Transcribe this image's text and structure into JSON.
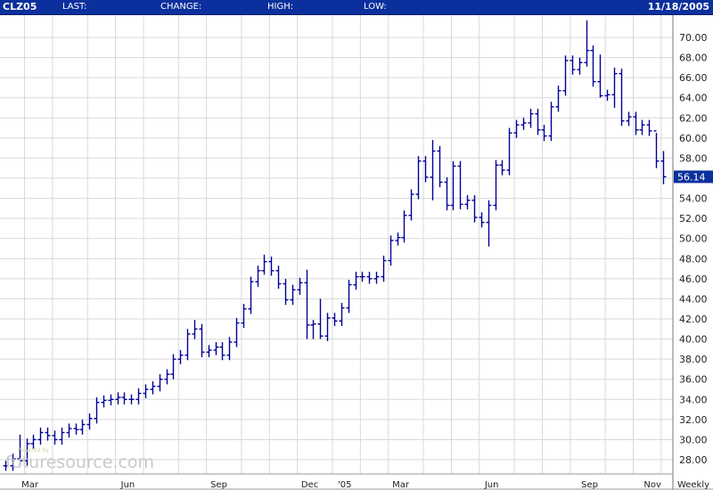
{
  "header": {
    "symbol": "CLZ05",
    "last_label": "LAST:",
    "change_label": "CHANGE:",
    "high_label": "HIGH:",
    "low_label": "LOW:",
    "date": "11/18/2005"
  },
  "logo": {
    "text": "futuresource.com",
    "tagline": "Powered by"
  },
  "colors": {
    "header": "#0b2f9c",
    "bars": "#000099",
    "grid": "#d9d9d9",
    "last_box": "#0b2f9c"
  },
  "chart_data": {
    "type": "ohlc",
    "title": "CLZ05",
    "period_label": "Weekly",
    "ylim": [
      26.6,
      72.6
    ],
    "y_ticks": [
      "28.00",
      "30.00",
      "32.00",
      "34.00",
      "36.00",
      "38.00",
      "40.00",
      "42.00",
      "44.00",
      "46.00",
      "48.00",
      "50.00",
      "52.00",
      "54.00",
      "56.00",
      "58.00",
      "60.00",
      "62.00",
      "64.00",
      "66.00",
      "68.00",
      "70.00"
    ],
    "x_labels": [
      {
        "label": "Mar",
        "week": 3
      },
      {
        "label": "Jun",
        "week": 17
      },
      {
        "label": "Sep",
        "week": 30
      },
      {
        "label": "Dec",
        "week": 43
      },
      {
        "label": "'05",
        "week": 48
      },
      {
        "label": "Mar",
        "week": 56
      },
      {
        "label": "Jun",
        "week": 69
      },
      {
        "label": "Sep",
        "week": 83
      },
      {
        "label": "Nov",
        "week": 92
      }
    ],
    "last_price": "56.14",
    "close": [
      27.4,
      28.1,
      27.9,
      29.6,
      30.0,
      30.7,
      30.4,
      30.0,
      30.7,
      31.1,
      31.0,
      31.5,
      32.1,
      33.7,
      33.9,
      34.0,
      34.2,
      34.0,
      34.0,
      34.6,
      35.0,
      35.3,
      36.0,
      36.5,
      38.0,
      38.4,
      40.5,
      41.0,
      38.7,
      38.9,
      39.2,
      38.4,
      39.7,
      41.6,
      43.0,
      45.7,
      46.8,
      47.7,
      46.8,
      45.5,
      43.9,
      44.9,
      45.6,
      41.4,
      41.5,
      40.3,
      42.1,
      41.8,
      43.1,
      45.4,
      46.2,
      46.2,
      46.0,
      46.2,
      47.8,
      49.8,
      50.1,
      52.3,
      54.4,
      57.7,
      56.1,
      58.7,
      55.6,
      53.3,
      57.2,
      53.4,
      53.8,
      52.1,
      51.6,
      53.3,
      57.3,
      56.8,
      60.5,
      61.3,
      61.5,
      62.4,
      60.8,
      60.2,
      63.1,
      64.7,
      67.7,
      66.8,
      67.5,
      68.7,
      65.6,
      64.2,
      64.3,
      66.4,
      61.7,
      62.1,
      60.8,
      61.3,
      60.7,
      57.7,
      56.14
    ],
    "range_overrides": {
      "2": [
        30.5,
        27.4
      ],
      "27": [
        41.9,
        40.0
      ],
      "37": [
        48.4,
        46.4
      ],
      "43": [
        46.9,
        40.0
      ],
      "44": [
        41.9,
        40.0
      ],
      "45": [
        44.0,
        40.0
      ],
      "61": [
        59.8,
        53.8
      ],
      "69": [
        53.8,
        49.2
      ],
      "83": [
        71.7,
        67.1
      ],
      "85": [
        68.3,
        64.0
      ],
      "87": [
        67.0,
        63.0
      ],
      "93": [
        60.5,
        57.0
      ],
      "94": [
        58.7,
        55.4
      ]
    }
  }
}
